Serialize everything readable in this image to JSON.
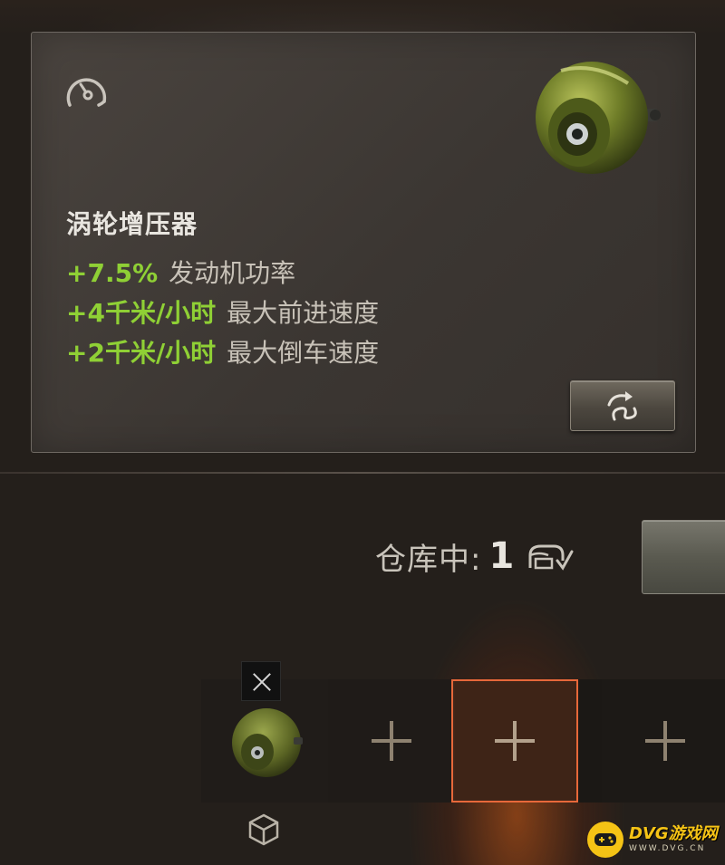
{
  "tooltip": {
    "icon": "speedometer-icon",
    "item_image": "turbocharger-image",
    "title": "涡轮增压器",
    "bonuses": [
      {
        "value": "+7.5%",
        "label": "发动机功率"
      },
      {
        "value": "+4千米/小时",
        "label": "最大前进速度"
      },
      {
        "value": "+2千米/小时",
        "label": "最大倒车速度"
      }
    ],
    "demount_button_icon": "demount-icon"
  },
  "stock": {
    "label": "仓库中:",
    "count": "1",
    "icon": "depot-check-icon"
  },
  "slots": [
    {
      "state": "equipped",
      "icon": "turbocharger-image"
    },
    {
      "state": "empty",
      "icon": "plus-icon"
    },
    {
      "state": "selected-empty",
      "icon": "plus-icon"
    },
    {
      "state": "empty",
      "icon": "plus-icon"
    }
  ],
  "footer_icon": "cube-icon",
  "watermark": {
    "title": "DVG游戏网",
    "subtitle": "WWW.DVG.CN"
  },
  "colors": {
    "bonus_value": "#8fd035",
    "selected_slot": "#e7683a",
    "watermark": "#f5c315"
  }
}
